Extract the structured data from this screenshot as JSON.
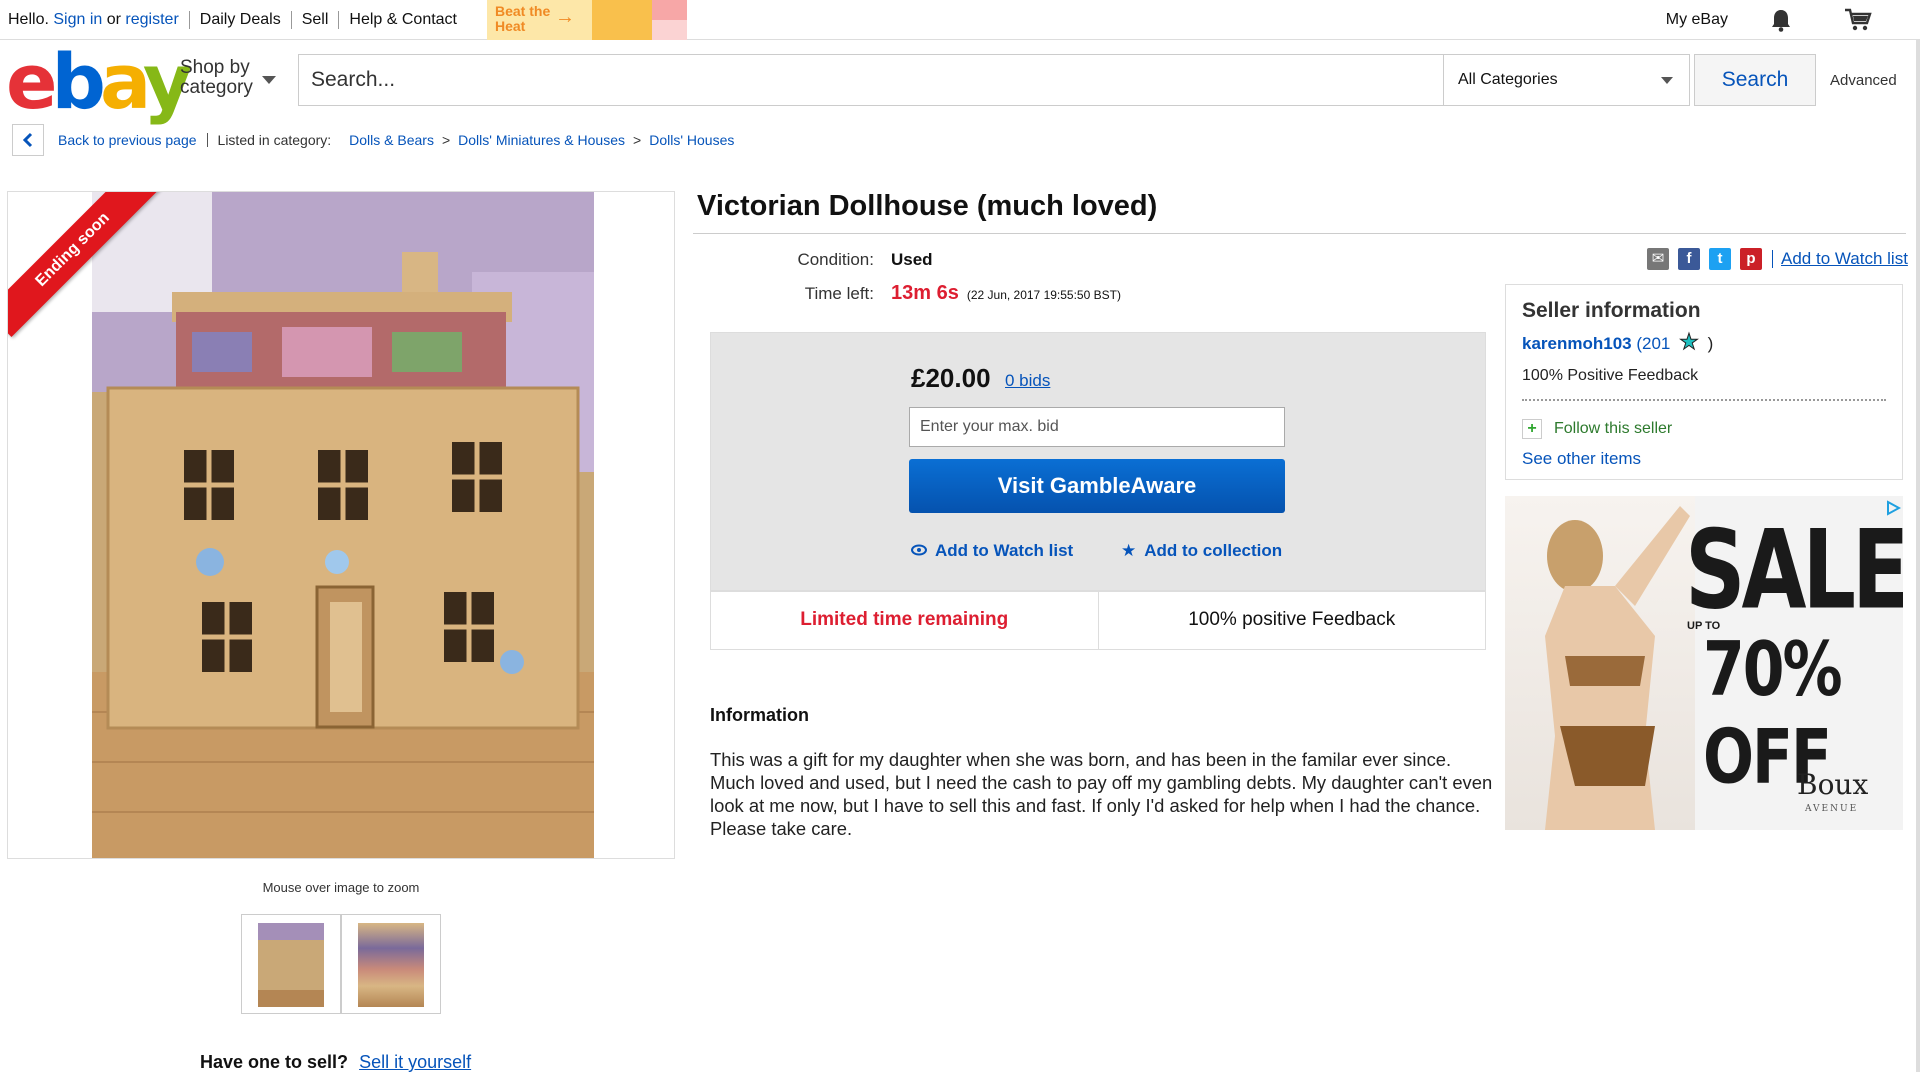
{
  "topbar": {
    "hello": "Hello.",
    "sign_in": "Sign in",
    "or": "or",
    "register": "register",
    "daily_deals": "Daily Deals",
    "sell": "Sell",
    "help": "Help & Contact",
    "promo_text": "Beat the Heat",
    "my_ebay": "My eBay"
  },
  "header": {
    "logo": {
      "e": "e",
      "b": "b",
      "a": "a",
      "y": "y"
    },
    "shop_by_line1": "Shop by",
    "shop_by_line2": "category",
    "search_placeholder": "Search...",
    "category": "All Categories",
    "search_button": "Search",
    "advanced": "Advanced"
  },
  "breadcrumb": {
    "back": "Back to previous page",
    "listed_in": "Listed in category:",
    "items": [
      "Dolls & Bears",
      "Dolls' Miniatures & Houses",
      "Dolls' Houses"
    ],
    "separator": ">"
  },
  "gallery": {
    "ribbon": "Ending soon",
    "zoom_hint": "Mouse over image to zoom",
    "sell_one": "Have one to sell?",
    "sell_link": "Sell it yourself"
  },
  "item": {
    "title": "Victorian Dollhouse (much loved)",
    "condition_label": "Condition:",
    "condition": "Used",
    "time_left_label": "Time left:",
    "time_left": "13m 6s",
    "end_time": "(22 Jun, 2017   19:55:50 BST)"
  },
  "bid": {
    "price": "£20.00",
    "bids": "0 bids",
    "max_bid_placeholder": "Enter your max. bid",
    "button": "Visit GambleAware",
    "watch": "Add to Watch list",
    "collection": "Add to collection",
    "limited": "Limited time remaining",
    "positive": "100% positive Feedback"
  },
  "description": {
    "heading": "Information",
    "text": "This was a gift for my daughter when she was born, and has been in the familar ever since. Much loved and used, but I need the cash to pay off my gambling debts. My daughter can't even look at me now, but I have to sell this and fast. If only I'd asked for help when I had the chance. Please take care."
  },
  "share": {
    "watch_link": "Add to Watch list",
    "icons": [
      "email-icon",
      "facebook-icon",
      "twitter-icon",
      "pinterest-icon"
    ]
  },
  "seller": {
    "heading": "Seller information",
    "username": "karenmoh103",
    "score_open": "(201",
    "score_close": ")",
    "feedback": "100% Positive Feedback",
    "follow": "Follow this seller",
    "other_items": "See other items"
  },
  "ad": {
    "headline": "SALE",
    "upto": "UP TO",
    "discount": "70% OFF",
    "brand": "Boux",
    "brand_sub": "AVENUE"
  },
  "colors": {
    "link": "#0654ba",
    "alert_red": "#dd1e31",
    "button_blue": "#0552ae",
    "ribbon_red": "#e0171d"
  }
}
